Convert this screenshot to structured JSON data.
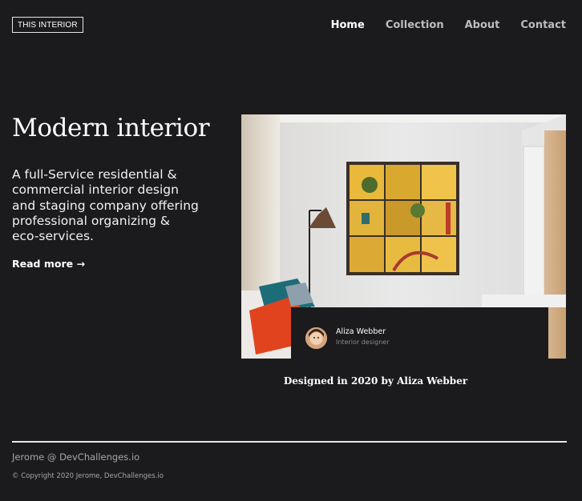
{
  "header": {
    "logo": "THIS INTERIOR",
    "nav": [
      {
        "label": "Home",
        "active": true
      },
      {
        "label": "Collection",
        "active": false
      },
      {
        "label": "About",
        "active": false
      },
      {
        "label": "Contact",
        "active": false
      }
    ]
  },
  "hero": {
    "title": "Modern interior",
    "description": "A full-Service residential & commercial interior design and staging company offering professional organizing & eco-services.",
    "read_more": "Read more →"
  },
  "designer": {
    "name": "Aliza Webber",
    "role": "Interior designer",
    "caption": "Designed in 2020 by Aliza Webber"
  },
  "footer": {
    "author": "Jerome @ DevChallenges.io",
    "copyright": "© Copyright 2020 Jerome, DevChallenges.io"
  },
  "colors": {
    "background": "#1b1b1d",
    "text": "#ffffff",
    "muted": "#a7a7a7"
  }
}
